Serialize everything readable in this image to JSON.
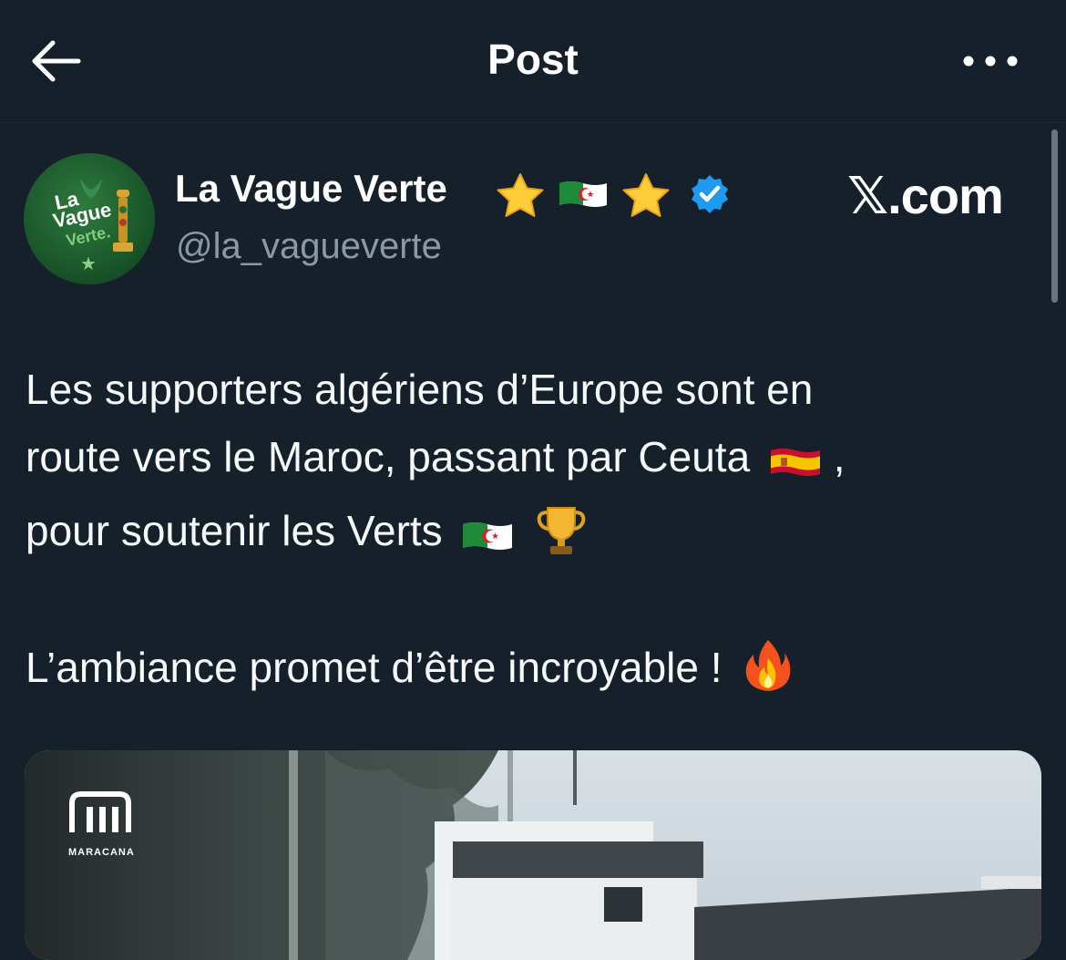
{
  "header": {
    "title": "Post",
    "back_icon": "arrow-left-icon",
    "more_icon": "more-horizontal-icon"
  },
  "author": {
    "display_name": "La Vague Verte",
    "name_emojis": [
      "star-emoji",
      "algeria-flag-emoji",
      "star-emoji"
    ],
    "verified": true,
    "verified_color": "#1d9bf0",
    "handle": "@la_vagueverte",
    "avatar_text": [
      "La",
      "Vague",
      "Verte."
    ]
  },
  "watermark": "𝕏.com",
  "post": {
    "line1": "Les supporters algériens d’Europe sont en",
    "line2": "route vers le Maroc, passant par Ceuta",
    "line2_suffix": ",",
    "line3": "pour soutenir les Verts",
    "line4": "L’ambiance promet d’être incroyable !"
  },
  "media": {
    "logo_text": "MARACANA"
  },
  "colors": {
    "background": "#15202b",
    "text": "#f7f9f9",
    "secondary_text": "#8b98a5",
    "accent": "#1d9bf0"
  }
}
